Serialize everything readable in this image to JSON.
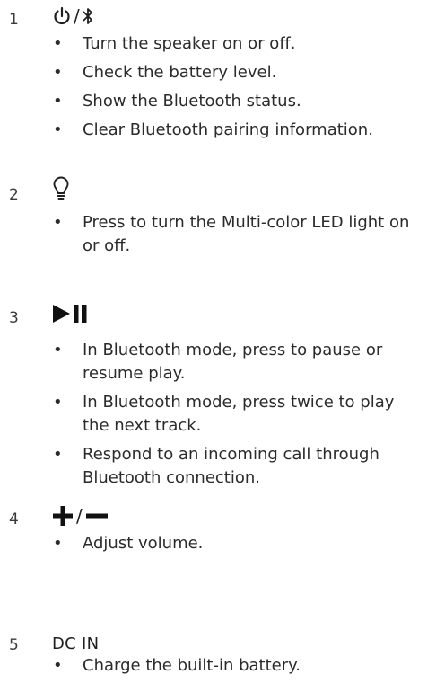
{
  "sections": [
    {
      "number": "1",
      "icons": [
        "power-icon",
        "bluetooth-icon"
      ],
      "separator": "/",
      "items": [
        "Turn the speaker on or off.",
        "Check the battery level.",
        "Show the Bluetooth status.",
        "Clear Bluetooth pairing information."
      ]
    },
    {
      "number": "2",
      "icons": [
        "light-bulb-icon"
      ],
      "items": [
        "Press to turn the Multi-color LED light on or off."
      ]
    },
    {
      "number": "3",
      "icons": [
        "play-pause-icon"
      ],
      "items": [
        "In Bluetooth mode, press to pause or resume play.",
        "In Bluetooth mode, press twice to play the next track.",
        "Respond to an incoming call through Bluetooth connection."
      ]
    },
    {
      "number": "4",
      "icons": [
        "plus-icon",
        "minus-icon"
      ],
      "separator": "/",
      "items": [
        "Adjust volume."
      ]
    },
    {
      "number": "5",
      "label": "DC IN",
      "items": [
        "Charge the built-in battery."
      ]
    }
  ],
  "bullet": "•"
}
